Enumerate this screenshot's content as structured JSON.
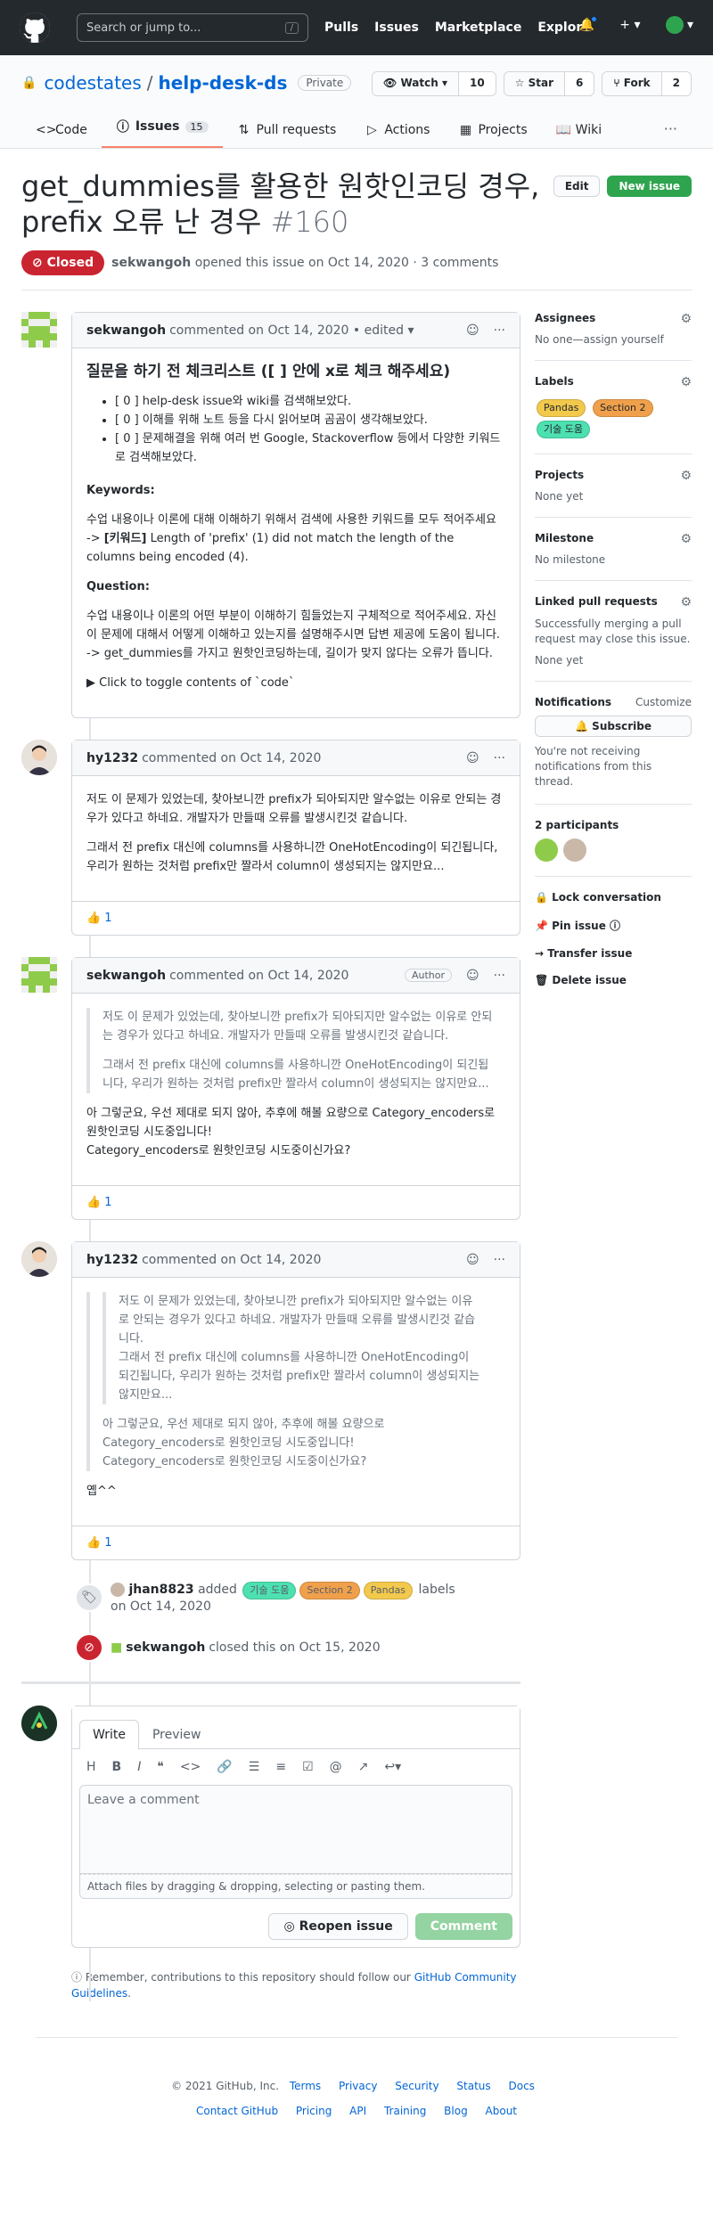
{
  "header": {
    "search_placeholder": "Search or jump to...",
    "slash": "/",
    "nav": [
      "Pulls",
      "Issues",
      "Marketplace",
      "Explore"
    ]
  },
  "repo": {
    "owner": "codestates",
    "name": "help-desk-ds",
    "visibility": "Private",
    "watch_label": "Watch",
    "watch_count": "10",
    "star_label": "Star",
    "star_count": "6",
    "fork_label": "Fork",
    "fork_count": "2",
    "tabs": [
      {
        "label": "Code",
        "icon": "code-icon"
      },
      {
        "label": "Issues",
        "icon": "issue-icon",
        "count": "15"
      },
      {
        "label": "Pull requests",
        "icon": "pull-request-icon"
      },
      {
        "label": "Actions",
        "icon": "play-icon"
      },
      {
        "label": "Projects",
        "icon": "project-icon"
      },
      {
        "label": "Wiki",
        "icon": "book-icon"
      }
    ],
    "more": "···"
  },
  "issue": {
    "title": "get_dummies를 활용한 원핫인코딩 경우, prefix 오류 난 경우",
    "number": "#160",
    "edit_label": "Edit",
    "new_issue_label": "New issue",
    "state": "Closed",
    "author": "sekwangoh",
    "meta_text": "opened this issue on Oct 14, 2020 · 3 comments"
  },
  "comments": [
    {
      "author": "sekwangoh",
      "action": "commented on Oct 14, 2020",
      "edited": "• edited ▾",
      "heading": "질문을 하기 전 체크리스트 ([ ] 안에 x로 체크 해주세요)",
      "checklist": [
        "[ 0 ] help-desk issue와 wiki를 검색해보았다.",
        "[ 0 ] 이해를 위해 노트 등을 다시 읽어보며 곰곰이 생각해보았다.",
        "[ 0 ] 문제해결을 위해 여러 번 Google, Stackoverflow 등에서 다양한 키워드로 검색해보았다."
      ],
      "kw_title": "Keywords:",
      "kw_text": "수업 내용이나 이론에 대해 이해하기 위해서 검색에 사용한 키워드를 모두 적어주세요",
      "kw_arrow": "-> ",
      "kw_bold": "[키워드]",
      "kw_rest": " Length of 'prefix' (1) did not match the length of the columns being encoded (4).",
      "q_title": "Question:",
      "q_text1": "수업 내용이나 이론의 어떤 부분이 이해하기 힘들었는지 구체적으로 적어주세요. 자신이 문제에 대해서 어떻게 이해하고 있는지를 설명해주시면 답변 제공에 도움이 됩니다.",
      "q_text2": "-> get_dummies를 가지고 원핫인코딩하는데, 길이가 맞지 않다는 오류가 뜹니다.",
      "toggle": "▶ Click to toggle contents of `code`"
    },
    {
      "author": "hy1232",
      "action": "commented on Oct 14, 2020",
      "p1": "저도 이 문제가 있었는데, 찾아보니깐 prefix가 되아되지만 알수없는 이유로 안되는 경우가 있다고 하네요. 개발자가 만들때 오류를 발생시킨것 같습니다.",
      "p2": "그래서 전 prefix 대신에 columns를 사용하니깐 OneHotEncoding이 되긴됩니다, 우리가 원하는 것처럼 prefix만 짤라서 column이 생성되지는 않지만요...",
      "reaction": "👍",
      "reaction_count": "1"
    },
    {
      "author": "sekwangoh",
      "action": "commented on Oct 14, 2020",
      "badge": "Author",
      "q1": "저도 이 문제가 있었는데, 찾아보니깐 prefix가 되아되지만 알수없는 이유로 안되는 경우가 있다고 하네요. 개발자가 만들때 오류를 발생시킨것 같습니다.",
      "q2": "그래서 전 prefix 대신에 columns를 사용하니깐 OneHotEncoding이 되긴됩니다, 우리가 원하는 것처럼 prefix만 짤라서 column이 생성되지는 않지만요...",
      "p1": "아 그렇군요, 우선 제대로 되지 않아, 추후에 해볼 요량으로 Category_encoders로 원핫인코딩 시도중입니다!",
      "p2": "Category_encoders로 원핫인코딩 시도중이신가요?",
      "reaction": "👍",
      "reaction_count": "1"
    },
    {
      "author": "hy1232",
      "action": "commented on Oct 14, 2020",
      "qq1": "저도 이 문제가 있었는데, 찾아보니깐 prefix가 되아되지만 알수없는 이유로 안되는 경우가 있다고 하네요. 개발자가 만들때 오류를 발생시킨것 같습니다.",
      "qq2": "그래서 전 prefix 대신에 columns를 사용하니깐 OneHotEncoding이 되긴됩니다, 우리가 원하는 것처럼 prefix만 짤라서 column이 생성되지는 않지만요...",
      "q1": "아 그렇군요, 우선 제대로 되지 않아, 추후에 해볼 요량으로 Category_encoders로 원핫인코딩 시도중입니다!",
      "q2": "Category_encoders로 원핫인코딩 시도중이신가요?",
      "p1": "옙^^",
      "reaction": "👍",
      "reaction_count": "1"
    }
  ],
  "events": {
    "labeled_user": "jhan8823",
    "labeled_action": "added",
    "labeled_suffix": "labels",
    "labeled_date": "on Oct 14, 2020",
    "closed_user": "sekwangoh",
    "closed_text": "closed this on Oct 15, 2020"
  },
  "labels": [
    {
      "name": "기술 도움",
      "color": "#4de0b0"
    },
    {
      "name": "Section 2",
      "color": "#f0a04b"
    },
    {
      "name": "Pandas",
      "color": "#f2c94c"
    }
  ],
  "new_comment": {
    "write_tab": "Write",
    "preview_tab": "Preview",
    "placeholder": "Leave a comment",
    "attach": "Attach files by dragging & dropping, selecting or pasting them.",
    "reopen": "Reopen issue",
    "comment": "Comment",
    "note_prefix": "Remember, contributions to this repository should follow our ",
    "note_link": "GitHub Community Guidelines",
    "note_suffix": "."
  },
  "sidebar": {
    "assignees_title": "Assignees",
    "assignees_value": "No one—assign yourself",
    "labels_title": "Labels",
    "labels": [
      {
        "name": "Pandas",
        "color": "#f2c94c"
      },
      {
        "name": "Section 2",
        "color": "#f0a04b"
      },
      {
        "name": "기술 도움",
        "color": "#4de0b0"
      }
    ],
    "projects_title": "Projects",
    "projects_value": "None yet",
    "milestone_title": "Milestone",
    "milestone_value": "No milestone",
    "linked_title": "Linked pull requests",
    "linked_desc": "Successfully merging a pull request may close this issue.",
    "linked_value": "None yet",
    "notif_title": "Notifications",
    "notif_customize": "Customize",
    "subscribe": "Subscribe",
    "notif_desc": "You're not receiving notifications from this thread.",
    "participants_title": "2 participants",
    "lock": "Lock conversation",
    "pin": "Pin issue",
    "transfer": "Transfer issue",
    "delete": "Delete issue"
  },
  "footer": {
    "copyright": "© 2021 GitHub, Inc.",
    "links1": [
      "Terms",
      "Privacy",
      "Security",
      "Status",
      "Docs"
    ],
    "links2": [
      "Contact GitHub",
      "Pricing",
      "API",
      "Training",
      "Blog",
      "About"
    ]
  }
}
